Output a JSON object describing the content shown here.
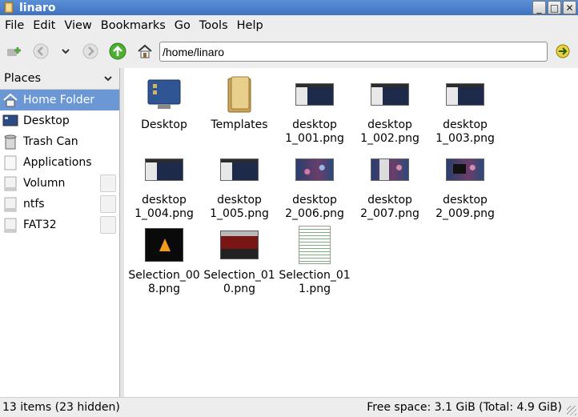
{
  "window": {
    "title": "linaro",
    "minimize": "_",
    "maximize": "□",
    "close": "✕"
  },
  "menu": [
    "File",
    "Edit",
    "View",
    "Bookmarks",
    "Go",
    "Tools",
    "Help"
  ],
  "address": {
    "value": "/home/linaro"
  },
  "sidebar": {
    "header": "Places",
    "items": [
      {
        "label": "Home Folder",
        "icon": "home-icon",
        "selected": true
      },
      {
        "label": "Desktop",
        "icon": "desktop-icon"
      },
      {
        "label": "Trash Can",
        "icon": "trash-icon"
      },
      {
        "label": "Applications",
        "icon": "applications-icon"
      },
      {
        "label": "Volumn",
        "icon": "drive-icon",
        "eject": true
      },
      {
        "label": "ntfs",
        "icon": "drive-icon",
        "eject": true
      },
      {
        "label": "FAT32",
        "icon": "drive-icon",
        "eject": true
      }
    ]
  },
  "files": [
    {
      "line1": "Desktop",
      "line2": ""
    },
    {
      "line1": "Templates",
      "line2": ""
    },
    {
      "line1": "desktop",
      "line2": "1_001.png"
    },
    {
      "line1": "desktop",
      "line2": "1_002.png"
    },
    {
      "line1": "desktop",
      "line2": "1_003.png"
    },
    {
      "line1": "desktop",
      "line2": "1_004.png"
    },
    {
      "line1": "desktop",
      "line2": "1_005.png"
    },
    {
      "line1": "desktop",
      "line2": "2_006.png"
    },
    {
      "line1": "desktop",
      "line2": "2_007.png"
    },
    {
      "line1": "desktop",
      "line2": "2_009.png"
    },
    {
      "line1": "Selection_00",
      "line2": "8.png"
    },
    {
      "line1": "Selection_01",
      "line2": "0.png"
    },
    {
      "line1": "Selection_01",
      "line2": "1.png"
    }
  ],
  "status": {
    "left": "13 items (23 hidden)",
    "right": "Free space: 3.1 GiB (Total: 4.9 GiB)"
  },
  "colors": {
    "selection": "#6b97d4",
    "titlebar": "#4a7fcb"
  }
}
